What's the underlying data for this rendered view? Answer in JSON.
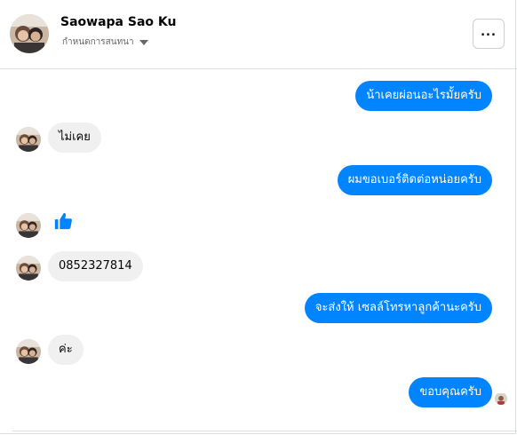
{
  "conversation": {
    "contact_name": "Saowapa Sao Ku",
    "subtitle": "กำหนดการสนทนา",
    "more_label": "..."
  },
  "messages": [
    {
      "side": "out",
      "text": "น้าเคยผ่อนอะไรมั้ยครับ"
    },
    {
      "side": "in",
      "text": "ไม่เคย"
    },
    {
      "side": "out",
      "text": "ผมขอเบอร์ติดต่อหน่อยครับ"
    },
    {
      "side": "in",
      "kind": "like",
      "icon": "thumbs-up-icon"
    },
    {
      "side": "in",
      "text": "0852327814"
    },
    {
      "side": "out",
      "text": "จะส่งให้ เซลล์โทรหาลูกค้านะครับ"
    },
    {
      "side": "in",
      "text": "ค่ะ"
    },
    {
      "side": "out",
      "text": "ขอบคุณครับ"
    }
  ],
  "colors": {
    "outgoing_bubble": "#0084ff",
    "incoming_bubble": "#f0f0f0",
    "like_icon": "#0084ff"
  }
}
